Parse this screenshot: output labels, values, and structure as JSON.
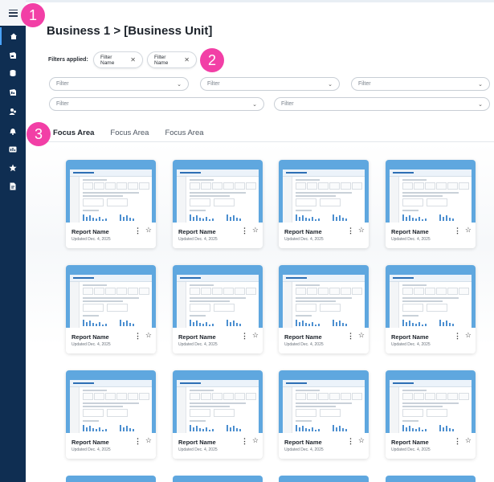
{
  "badges": [
    "1",
    "2",
    "3"
  ],
  "nav": {
    "menu_icon": "hamburger-menu-icon",
    "items": [
      {
        "icon": "home-icon",
        "active": true
      },
      {
        "icon": "report-icon"
      },
      {
        "icon": "database-icon"
      },
      {
        "icon": "chart-icon"
      },
      {
        "icon": "users-icon"
      },
      {
        "icon": "bell-icon"
      },
      {
        "icon": "dashboard-icon"
      },
      {
        "icon": "star-icon"
      },
      {
        "icon": "document-icon"
      }
    ]
  },
  "header": {
    "title": "Business 1 > [Business Unit]"
  },
  "filters": {
    "applied_label": "Filters applied:",
    "chips": [
      {
        "label": "Filter Name",
        "remove": "✕"
      },
      {
        "label": "Filter Name",
        "remove": "✕"
      }
    ],
    "selects": [
      {
        "placeholder": "Filter"
      },
      {
        "placeholder": "Filter"
      },
      {
        "placeholder": "Filter"
      },
      {
        "placeholder": "Filter"
      },
      {
        "placeholder": "Filter"
      }
    ]
  },
  "tabs": [
    {
      "label": "Focus Area",
      "active": true
    },
    {
      "label": "Focus Area"
    },
    {
      "label": "Focus Area"
    }
  ],
  "reports": [
    {
      "name": "Report Name",
      "updated": "Updated Dec. 4, 2025"
    },
    {
      "name": "Report Name",
      "updated": "Updated Dec. 4, 2025"
    },
    {
      "name": "Report Name",
      "updated": "Updated Dec. 4, 2025"
    },
    {
      "name": "Report Name",
      "updated": "Updated Dec. 4, 2025"
    },
    {
      "name": "Report Name",
      "updated": "Updated Dec. 4, 2025"
    },
    {
      "name": "Report Name",
      "updated": "Updated Dec. 4, 2025"
    },
    {
      "name": "Report Name",
      "updated": "Updated Dec. 4, 2025"
    },
    {
      "name": "Report Name",
      "updated": "Updated Dec. 4, 2025"
    },
    {
      "name": "Report Name",
      "updated": "Updated Dec. 4, 2025"
    },
    {
      "name": "Report Name",
      "updated": "Updated Dec. 4, 2025"
    },
    {
      "name": "Report Name",
      "updated": "Updated Dec. 4, 2025"
    },
    {
      "name": "Report Name",
      "updated": "Updated Dec. 4, 2025"
    }
  ],
  "card_actions": {
    "more": "⋮",
    "favorite": "☆"
  },
  "colors": {
    "sidebar": "#0f2e52",
    "badge": "#f23fa6",
    "thumb": "#5fa7df"
  }
}
